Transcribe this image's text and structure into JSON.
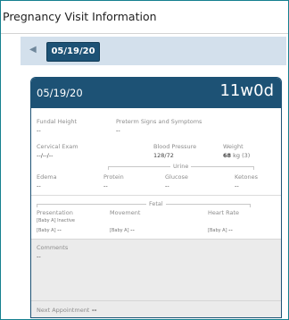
{
  "window": {
    "title": "Pregnancy Visit Information"
  },
  "date_strip": {
    "selected_date": "05/19/20"
  },
  "card": {
    "date": "05/19/20",
    "gestational_age": "11w0d",
    "fundal_height": {
      "label": "Fundal Height",
      "value": "--"
    },
    "preterm": {
      "label": "Preterm Signs and Symptoms",
      "value": "--"
    },
    "cervical_exam": {
      "label": "Cervical Exam",
      "value": "--/--/--"
    },
    "blood_pressure": {
      "label": "Blood Pressure",
      "value": "128/72"
    },
    "weight": {
      "label": "Weight",
      "value": "68",
      "unit": "kg (3)"
    },
    "urine": {
      "title": "Urine",
      "edema": {
        "label": "Edema",
        "value": "--"
      },
      "protein": {
        "label": "Protein",
        "value": "--"
      },
      "glucose": {
        "label": "Glucose",
        "value": "--"
      },
      "ketones": {
        "label": "Ketones",
        "value": "--"
      }
    },
    "fetal": {
      "title": "Fetal",
      "presentation": {
        "label": "Presentation",
        "baby": "[Baby A]",
        "status": "Inactive",
        "value": "--"
      },
      "movement": {
        "label": "Movement",
        "baby": "[Baby A]",
        "value": "--"
      },
      "heart_rate": {
        "label": "Heart Rate",
        "baby": "[Baby A]",
        "value": "--"
      }
    },
    "comments": {
      "label": "Comments",
      "value": "--"
    },
    "next_appointment": {
      "label": "Next Appointment",
      "value": "--"
    }
  }
}
